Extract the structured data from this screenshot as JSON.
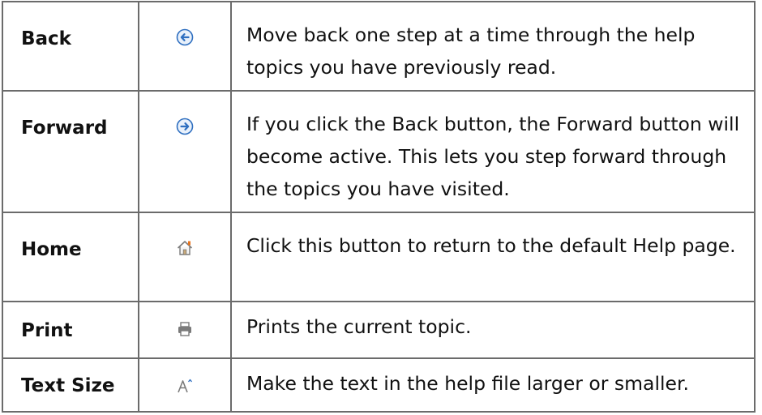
{
  "table": {
    "rows": [
      {
        "name": "Back",
        "icon": "back-arrow-icon",
        "description": "Move back one step at a time through the help topics you have previously read."
      },
      {
        "name": "Forward",
        "icon": "forward-arrow-icon",
        "description": "If you click the Back button, the Forward button will become active. This lets you step forward through the topics you have visited."
      },
      {
        "name": "Home",
        "icon": "home-icon",
        "description": "Click this button to return to the default Help page."
      },
      {
        "name": "Print",
        "icon": "printer-icon",
        "description": "Prints the current topic."
      },
      {
        "name": "Text Size",
        "icon": "text-size-icon",
        "description": "Make the text in the help file larger or smaller."
      }
    ]
  },
  "colors": {
    "border": "#6b6b6b",
    "arrow_blue": "#2f6fc0",
    "home_orange": "#e8731c",
    "icon_gray": "#7a7a7a"
  }
}
